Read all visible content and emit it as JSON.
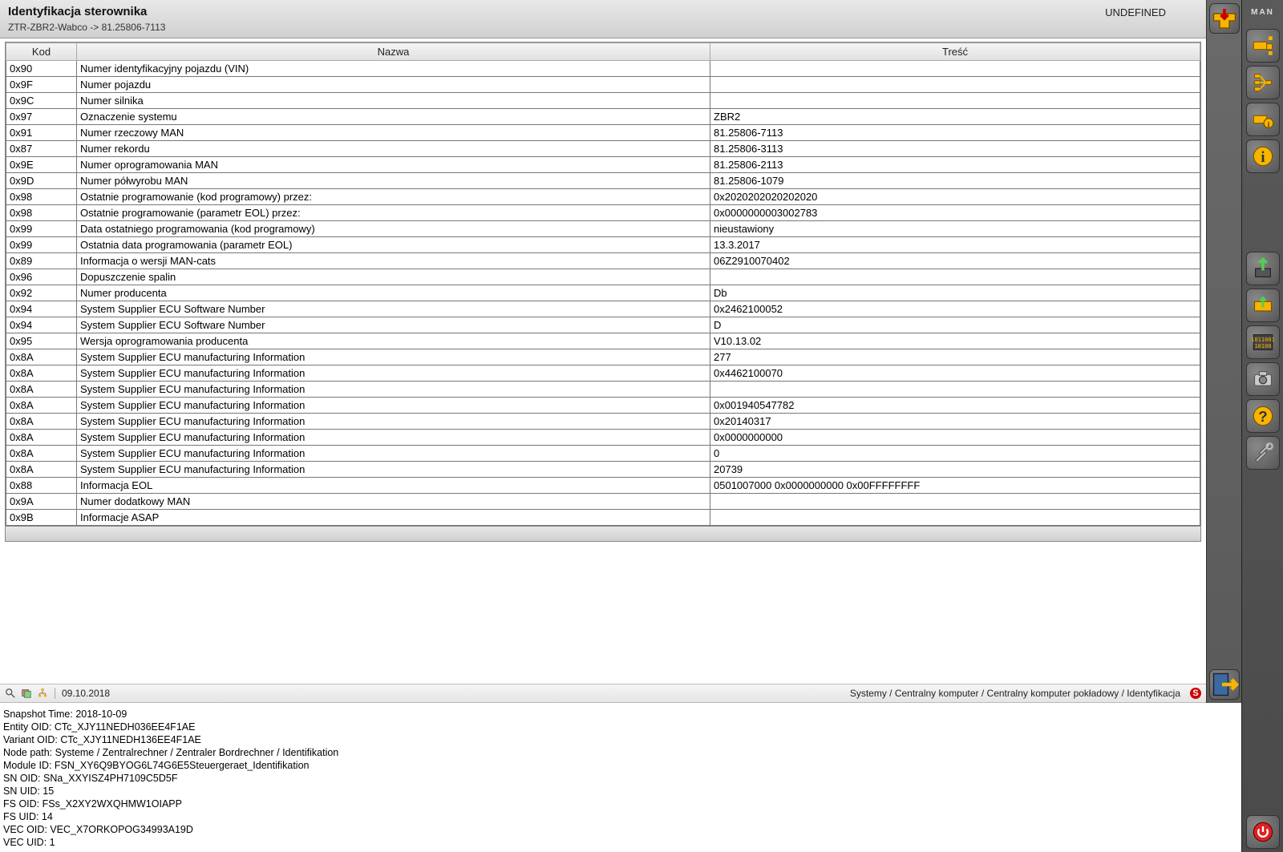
{
  "header": {
    "title": "Identyfikacja sterownika",
    "subtitle": "ZTR-ZBR2-Wabco -> 81.25806-7113",
    "status": "UNDEFINED"
  },
  "columns": {
    "kod": "Kod",
    "nazwa": "Nazwa",
    "tresc": "Treść"
  },
  "rows": [
    {
      "kod": "0x90",
      "nazwa": "Numer identyfikacyjny pojazdu (VIN)",
      "tresc": ""
    },
    {
      "kod": "0x9F",
      "nazwa": "Numer pojazdu",
      "tresc": ""
    },
    {
      "kod": "0x9C",
      "nazwa": "Numer silnika",
      "tresc": ""
    },
    {
      "kod": "0x97",
      "nazwa": "Oznaczenie systemu",
      "tresc": "ZBR2"
    },
    {
      "kod": "0x91",
      "nazwa": "Numer rzeczowy MAN",
      "tresc": "81.25806-7113"
    },
    {
      "kod": "0x87",
      "nazwa": "Numer rekordu",
      "tresc": "81.25806-3113"
    },
    {
      "kod": "0x9E",
      "nazwa": "Numer oprogramowania MAN",
      "tresc": "81.25806-2113"
    },
    {
      "kod": "0x9D",
      "nazwa": "Numer półwyrobu MAN",
      "tresc": "81.25806-1079"
    },
    {
      "kod": "0x98",
      "nazwa": "Ostatnie programowanie (kod programowy) przez:",
      "tresc": "0x2020202020202020"
    },
    {
      "kod": "0x98",
      "nazwa": "Ostatnie programowanie (parametr EOL) przez:",
      "tresc": "0x0000000003002783"
    },
    {
      "kod": "0x99",
      "nazwa": "Data ostatniego programowania (kod programowy)",
      "tresc": "nieustawiony"
    },
    {
      "kod": "0x99",
      "nazwa": "Ostatnia data programowania (parametr EOL)",
      "tresc": "13.3.2017"
    },
    {
      "kod": "0x89",
      "nazwa": "Informacja o wersji MAN-cats",
      "tresc": "06Z2910070402"
    },
    {
      "kod": "0x96",
      "nazwa": "Dopuszczenie spalin",
      "tresc": ""
    },
    {
      "kod": "0x92",
      "nazwa": "Numer producenta",
      "tresc": "Db"
    },
    {
      "kod": "0x94",
      "nazwa": "System Supplier ECU Software Number",
      "tresc": "0x2462100052"
    },
    {
      "kod": "0x94",
      "nazwa": "System Supplier ECU Software Number",
      "tresc": "D"
    },
    {
      "kod": "0x95",
      "nazwa": "Wersja oprogramowania producenta",
      "tresc": "V10.13.02"
    },
    {
      "kod": "0x8A",
      "nazwa": "System Supplier ECU manufacturing Information",
      "tresc": "277"
    },
    {
      "kod": "0x8A",
      "nazwa": "System Supplier ECU manufacturing Information",
      "tresc": "0x4462100070"
    },
    {
      "kod": "0x8A",
      "nazwa": "System Supplier ECU manufacturing Information",
      "tresc": ""
    },
    {
      "kod": "0x8A",
      "nazwa": "System Supplier ECU manufacturing Information",
      "tresc": "0x001940547782"
    },
    {
      "kod": "0x8A",
      "nazwa": "System Supplier ECU manufacturing Information",
      "tresc": "0x20140317"
    },
    {
      "kod": "0x8A",
      "nazwa": "System Supplier ECU manufacturing Information",
      "tresc": "0x0000000000"
    },
    {
      "kod": "0x8A",
      "nazwa": "System Supplier ECU manufacturing Information",
      "tresc": "0"
    },
    {
      "kod": "0x8A",
      "nazwa": "System Supplier ECU manufacturing Information",
      "tresc": "20739"
    },
    {
      "kod": "0x88",
      "nazwa": "Informacja EOL",
      "tresc": "0501007000  0x0000000000 0x00FFFFFFFF"
    },
    {
      "kod": "0x9A",
      "nazwa": "Numer dodatkowy MAN",
      "tresc": ""
    },
    {
      "kod": "0x9B",
      "nazwa": "Informacje ASAP",
      "tresc": ""
    }
  ],
  "statusbar": {
    "date": "09.10.2018",
    "breadcrumb": "Systemy / Centralny komputer / Centralny komputer pokładowy / Identyfikacja"
  },
  "snapshot": {
    "l1": "Snapshot Time: 2018-10-09",
    "l2": "Entity OID: CTc_XJY11NEDH036EE4F1AE",
    "l3": "Variant OID: CTc_XJY11NEDH136EE4F1AE",
    "l4": "Node path: Systeme / Zentralrechner / Zentraler Bordrechner / Identifikation",
    "l5": "Module ID: FSN_XY6Q9BYOG6L74G6E5Steuergeraet_Identifikation",
    "l6": "SN OID: SNa_XXYISZ4PH7109C5D5F",
    "l7": "SN UID: 15",
    "l8": "FS OID: FSs_X2XY2WXQHMW1OIAPP",
    "l9": "FS UID: 14",
    "l10": "VEC OID: VEC_X7ORKOPOG34993A19D",
    "l11": "VEC UID: 1"
  },
  "logo": "MAN"
}
